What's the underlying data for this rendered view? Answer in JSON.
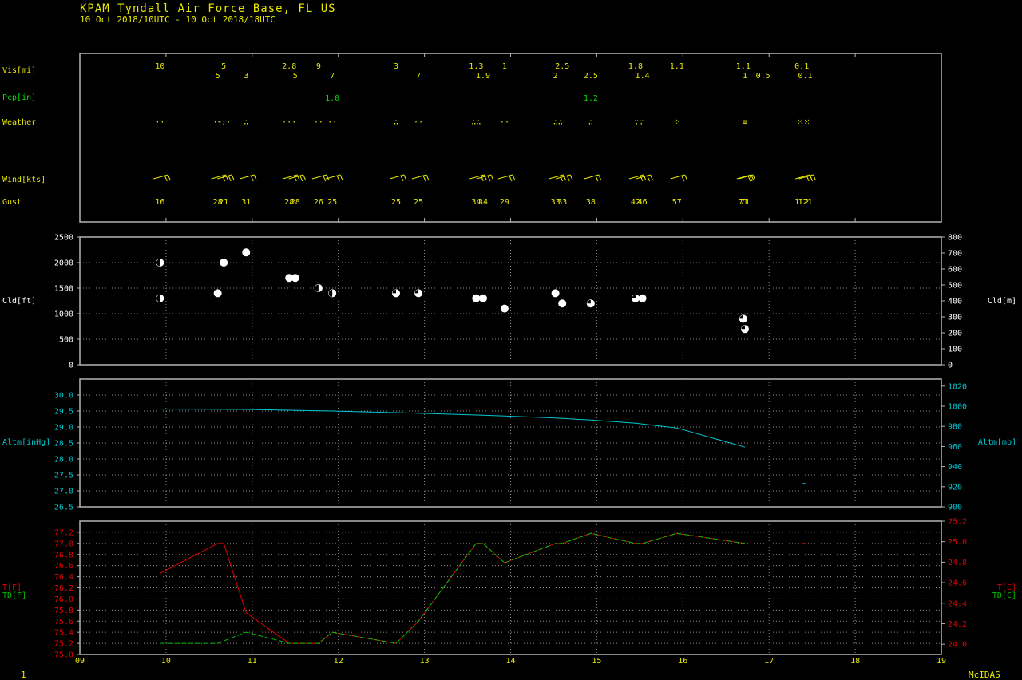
{
  "header": {
    "station": "KPAM  Tyndall Air Force Base, FL US",
    "period": "10 Oct 2018/10UTC - 10 Oct 2018/18UTC"
  },
  "footer": {
    "page_number": "1",
    "brand": "McIDAS"
  },
  "colors": {
    "frame": "#b4b4b4",
    "grid": "#8c8c8c",
    "obs": "#e8e800",
    "precip": "#00e000",
    "cloud": "#ffffff",
    "altimeter": "#00c8d2",
    "temp": "#e00000",
    "dewpoint": "#00c000"
  },
  "labels": {
    "vis": "Vis[mi]",
    "pcp": "Pcp[in]",
    "weather": "Weather",
    "wind": "Wind[kts]",
    "gust": "Gust",
    "cld_ft": "Cld[ft]",
    "cld_m": "Cld[m]",
    "altm_inhg": "Altm[inHg]",
    "altm_mb": "Altm[mb]",
    "t_f": "T[F]",
    "td_f": "TD[F]",
    "t_c": "T[C]",
    "td_c": "TD[C]"
  },
  "chart_data": [
    {
      "type": "table",
      "panel": "observations",
      "x_ticks": [
        "09",
        "10",
        "11",
        "12",
        "13",
        "14",
        "15",
        "16",
        "17",
        "18",
        "19"
      ],
      "visibility": [
        {
          "hour": 9.93,
          "value": "10"
        },
        {
          "hour": 10.6,
          "value": "5"
        },
        {
          "hour": 10.67,
          "value": "5"
        },
        {
          "hour": 10.93,
          "value": "3"
        },
        {
          "hour": 11.43,
          "value": "2.8"
        },
        {
          "hour": 11.5,
          "value": "5"
        },
        {
          "hour": 11.77,
          "value": "9"
        },
        {
          "hour": 11.93,
          "value": "7"
        },
        {
          "hour": 12.67,
          "value": "3"
        },
        {
          "hour": 12.93,
          "value": "7"
        },
        {
          "hour": 13.6,
          "value": "1.3"
        },
        {
          "hour": 13.68,
          "value": "1.9"
        },
        {
          "hour": 13.93,
          "value": "1"
        },
        {
          "hour": 14.52,
          "value": "2"
        },
        {
          "hour": 14.6,
          "value": "2.5"
        },
        {
          "hour": 14.93,
          "value": "2.5"
        },
        {
          "hour": 15.45,
          "value": "1.8"
        },
        {
          "hour": 15.53,
          "value": "1.4"
        },
        {
          "hour": 15.93,
          "value": "1.1"
        },
        {
          "hour": 16.72,
          "value": "1"
        },
        {
          "hour": 16.7,
          "value": "1.1"
        },
        {
          "hour": 16.93,
          "value": "0.5"
        },
        {
          "hour": 17.38,
          "value": "0.1"
        },
        {
          "hour": 17.42,
          "value": "0.1"
        }
      ],
      "precip": [
        {
          "hour": 11.93,
          "value": "1.0"
        },
        {
          "hour": 14.93,
          "value": "1.2"
        }
      ],
      "weather": [
        {
          "hour": 9.93,
          "symbol": "··"
        },
        {
          "hour": 10.6,
          "symbol": "··"
        },
        {
          "hour": 10.67,
          "symbol": "·:·"
        },
        {
          "hour": 10.93,
          "symbol": "∴"
        },
        {
          "hour": 11.43,
          "symbol": "···"
        },
        {
          "hour": 11.77,
          "symbol": "··"
        },
        {
          "hour": 11.93,
          "symbol": "··"
        },
        {
          "hour": 12.67,
          "symbol": "∴"
        },
        {
          "hour": 12.93,
          "symbol": "··"
        },
        {
          "hour": 13.6,
          "symbol": "∴∴"
        },
        {
          "hour": 13.93,
          "symbol": "··"
        },
        {
          "hour": 14.55,
          "symbol": "∴∴"
        },
        {
          "hour": 14.93,
          "symbol": "∴"
        },
        {
          "hour": 15.49,
          "symbol": "∵∵"
        },
        {
          "hour": 15.93,
          "symbol": "⁘"
        },
        {
          "hour": 16.72,
          "symbol": "≡"
        },
        {
          "hour": 17.4,
          "symbol": "⁙⁙"
        }
      ],
      "wind_barbs_hours": [
        9.93,
        10.6,
        10.67,
        10.93,
        11.43,
        11.5,
        11.77,
        11.93,
        12.67,
        12.93,
        13.6,
        13.68,
        13.93,
        14.52,
        14.6,
        14.93,
        15.45,
        15.53,
        15.93,
        16.7,
        16.72,
        17.38,
        17.42
      ],
      "gust": [
        {
          "hour": 9.93,
          "value": "16"
        },
        {
          "hour": 10.6,
          "value": "28"
        },
        {
          "hour": 10.67,
          "value": "21"
        },
        {
          "hour": 10.93,
          "value": "31"
        },
        {
          "hour": 11.43,
          "value": "28"
        },
        {
          "hour": 11.5,
          "value": "28"
        },
        {
          "hour": 11.77,
          "value": "26"
        },
        {
          "hour": 11.93,
          "value": "25"
        },
        {
          "hour": 12.67,
          "value": "25"
        },
        {
          "hour": 12.93,
          "value": "25"
        },
        {
          "hour": 13.6,
          "value": "34"
        },
        {
          "hour": 13.68,
          "value": "34"
        },
        {
          "hour": 13.93,
          "value": "29"
        },
        {
          "hour": 14.52,
          "value": "33"
        },
        {
          "hour": 14.6,
          "value": "33"
        },
        {
          "hour": 14.93,
          "value": "38"
        },
        {
          "hour": 15.45,
          "value": "42"
        },
        {
          "hour": 15.53,
          "value": "46"
        },
        {
          "hour": 15.93,
          "value": "57"
        },
        {
          "hour": 16.7,
          "value": "71"
        },
        {
          "hour": 16.72,
          "value": "71"
        },
        {
          "hour": 17.38,
          "value": "112"
        },
        {
          "hour": 17.42,
          "value": "121"
        }
      ]
    },
    {
      "type": "scatter",
      "panel": "cloud",
      "ylim_ft": [
        0,
        2500
      ],
      "ylim_m": [
        0,
        800
      ],
      "yticks_left": [
        "0",
        "500",
        "1000",
        "1500",
        "2000",
        "2500"
      ],
      "yticks_right": [
        "0",
        "100",
        "200",
        "300",
        "400",
        "500",
        "600",
        "700",
        "800"
      ],
      "points": [
        {
          "x": 9.93,
          "y": 2000,
          "cover": "half"
        },
        {
          "x": 9.93,
          "y": 1300,
          "cover": "half"
        },
        {
          "x": 10.6,
          "y": 1400,
          "cover": "full"
        },
        {
          "x": 10.67,
          "y": 2000,
          "cover": "full"
        },
        {
          "x": 10.93,
          "y": 2200,
          "cover": "full"
        },
        {
          "x": 11.43,
          "y": 1700,
          "cover": "full"
        },
        {
          "x": 11.5,
          "y": 1700,
          "cover": "full"
        },
        {
          "x": 11.77,
          "y": 1500,
          "cover": "half"
        },
        {
          "x": 11.93,
          "y": 1400,
          "cover": "half"
        },
        {
          "x": 12.67,
          "y": 1400,
          "cover": "three-quarter"
        },
        {
          "x": 12.93,
          "y": 1400,
          "cover": "three-quarter"
        },
        {
          "x": 13.6,
          "y": 1300,
          "cover": "full"
        },
        {
          "x": 13.68,
          "y": 1300,
          "cover": "full"
        },
        {
          "x": 13.93,
          "y": 1100,
          "cover": "full"
        },
        {
          "x": 14.52,
          "y": 1400,
          "cover": "full"
        },
        {
          "x": 14.6,
          "y": 1200,
          "cover": "full"
        },
        {
          "x": 14.93,
          "y": 1200,
          "cover": "three-quarter"
        },
        {
          "x": 15.45,
          "y": 1300,
          "cover": "three-quarter"
        },
        {
          "x": 15.53,
          "y": 1300,
          "cover": "full"
        },
        {
          "x": 16.7,
          "y": 900,
          "cover": "three-quarter"
        },
        {
          "x": 16.72,
          "y": 700,
          "cover": "three-quarter"
        }
      ]
    },
    {
      "type": "line",
      "panel": "altimeter",
      "ylim_inhg": [
        26.5,
        30.5
      ],
      "ylim_mb": [
        900,
        1027
      ],
      "yticks_left": [
        "26.5",
        "27.0",
        "27.5",
        "28.0",
        "28.5",
        "29.0",
        "29.5",
        "30.0"
      ],
      "yticks_right": [
        "900",
        "920",
        "940",
        "960",
        "980",
        "1000",
        "1020"
      ],
      "series": [
        {
          "points": [
            [
              9.93,
              29.56
            ],
            [
              10.93,
              29.55
            ],
            [
              11.93,
              29.5
            ],
            [
              12.93,
              29.43
            ],
            [
              13.68,
              29.37
            ],
            [
              14.52,
              29.28
            ],
            [
              14.93,
              29.22
            ],
            [
              15.45,
              29.12
            ],
            [
              15.93,
              28.97
            ],
            [
              16.72,
              28.37
            ]
          ]
        },
        {
          "points": [
            [
              17.38,
              27.22
            ],
            [
              17.42,
              27.24
            ]
          ]
        }
      ]
    },
    {
      "type": "line",
      "panel": "temperature",
      "ylim_f": [
        75.0,
        77.4
      ],
      "ylim_c": [
        23.9,
        25.2
      ],
      "yticks_left": [
        "75.0",
        "75.2",
        "75.4",
        "75.6",
        "75.8",
        "76.0",
        "76.2",
        "76.4",
        "76.6",
        "76.8",
        "77.0",
        "77.2"
      ],
      "yticks_right": [
        "24.0",
        "24.2",
        "24.4",
        "24.6",
        "24.8",
        "25.0",
        "25.2"
      ],
      "series": [
        {
          "name": "T[F]",
          "points": [
            [
              9.93,
              76.46
            ],
            [
              10.6,
              77.0
            ],
            [
              10.67,
              77.0
            ],
            [
              10.93,
              75.75
            ],
            [
              11.43,
              75.2
            ],
            [
              11.77,
              75.2
            ],
            [
              11.93,
              75.4
            ],
            [
              12.67,
              75.2
            ],
            [
              12.93,
              75.6
            ],
            [
              13.6,
              77.0
            ],
            [
              13.68,
              77.0
            ],
            [
              13.93,
              76.65
            ],
            [
              14.52,
              77.0
            ],
            [
              14.6,
              77.0
            ],
            [
              14.93,
              77.18
            ],
            [
              15.45,
              77.0
            ],
            [
              15.53,
              77.0
            ],
            [
              15.93,
              77.18
            ],
            [
              16.72,
              77.0
            ]
          ]
        },
        {
          "name": "TD[F]",
          "points": [
            [
              9.93,
              75.2
            ],
            [
              10.6,
              75.2
            ],
            [
              10.93,
              75.4
            ],
            [
              11.43,
              75.2
            ],
            [
              11.77,
              75.2
            ],
            [
              11.93,
              75.4
            ],
            [
              12.67,
              75.2
            ],
            [
              12.93,
              75.6
            ],
            [
              13.6,
              77.0
            ],
            [
              13.68,
              77.0
            ],
            [
              13.93,
              76.65
            ],
            [
              14.52,
              77.0
            ],
            [
              14.6,
              77.0
            ],
            [
              14.93,
              77.18
            ],
            [
              15.45,
              77.0
            ],
            [
              15.53,
              77.0
            ],
            [
              15.93,
              77.18
            ],
            [
              16.72,
              77.0
            ]
          ]
        },
        {
          "name": "T[F] tail",
          "points": [
            [
              17.38,
              77.0
            ],
            [
              17.42,
              77.0
            ]
          ]
        }
      ]
    }
  ]
}
